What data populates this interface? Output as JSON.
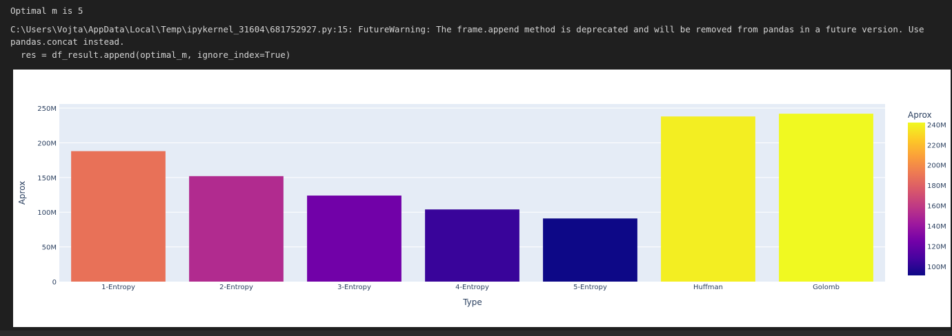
{
  "output": {
    "line1": "Optimal m is 5",
    "warning_line1": "C:\\Users\\Vojta\\AppData\\Local\\Temp\\ipykernel_31604\\681752927.py:15: FutureWarning: The frame.append method is deprecated and will be removed from pandas in a future version. Use",
    "warning_line2": "pandas.concat instead.",
    "warning_line3": "  res = df_result.append(optimal_m, ignore_index=True)"
  },
  "chart_data": {
    "type": "bar",
    "title": "",
    "xlabel": "Type",
    "ylabel": "Aprox",
    "categories": [
      "1-Entropy",
      "2-Entropy",
      "3-Entropy",
      "4-Entropy",
      "5-Entropy",
      "Huffman",
      "Golomb"
    ],
    "values": [
      188000000,
      152000000,
      124000000,
      104000000,
      91000000,
      238000000,
      242000000
    ],
    "ylim": [
      0,
      256000000
    ],
    "y_ticks": [
      0,
      50000000,
      100000000,
      150000000,
      200000000,
      250000000
    ],
    "y_tick_labels": [
      "0",
      "50M",
      "100M",
      "150M",
      "200M",
      "250M"
    ],
    "colorscale": "plasma",
    "colorbar": {
      "title": "Aprox",
      "range": [
        91000000,
        242000000
      ],
      "ticks": [
        100000000,
        120000000,
        140000000,
        160000000,
        180000000,
        200000000,
        220000000,
        240000000
      ],
      "tick_labels": [
        "100M",
        "120M",
        "140M",
        "160M",
        "180M",
        "200M",
        "220M",
        "240M"
      ]
    },
    "plot_background": "#e5ecf6",
    "grid": true
  }
}
